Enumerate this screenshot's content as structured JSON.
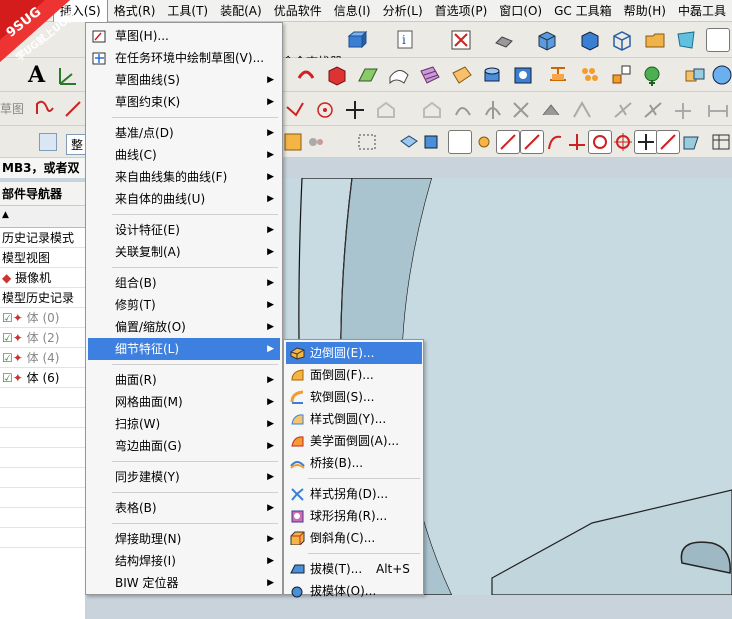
{
  "menubar": {
    "items": [
      "插入(S)",
      "格式(R)",
      "工具(T)",
      "装配(A)",
      "优品软件",
      "信息(I)",
      "分析(L)",
      "首选项(P)",
      "窗口(O)",
      "GC 工具箱",
      "帮助(H)",
      "中磊工具"
    ],
    "active_index": 0
  },
  "toolbar": {
    "command_finder": "命令查找器",
    "sketch_label": "草图",
    "text_icon": "A"
  },
  "selection_filter": {
    "value": "整"
  },
  "status_hint": "MB3，或者双",
  "navigator": {
    "title": "部件导航器",
    "rows": [
      {
        "label": "历史记录模式",
        "gray": false
      },
      {
        "label": "模型视图",
        "gray": false
      },
      {
        "label": "摄像机",
        "gray": false
      },
      {
        "label": "模型历史记录",
        "gray": false
      },
      {
        "label": "体 (0)",
        "gray": true
      },
      {
        "label": "体 (2)",
        "gray": true
      },
      {
        "label": "体 (4)",
        "gray": true
      },
      {
        "label": "体 (6)",
        "gray": false
      }
    ]
  },
  "watermark": {
    "line1": "9SUG",
    "line2": "学UG就上UG网"
  },
  "insert_menu": {
    "items": [
      {
        "label": "草图(H)...",
        "arrow": false,
        "icon": "sketch-icon"
      },
      {
        "label": "在任务环境中绘制草图(V)...",
        "arrow": false,
        "icon": "task-sketch-icon"
      },
      {
        "label": "草图曲线(S)",
        "arrow": true,
        "icon": ""
      },
      {
        "label": "草图约束(K)",
        "arrow": true,
        "icon": ""
      },
      {
        "label": "基准/点(D)",
        "arrow": true,
        "icon": ""
      },
      {
        "label": "曲线(C)",
        "arrow": true,
        "icon": ""
      },
      {
        "label": "来自曲线集的曲线(F)",
        "arrow": true,
        "icon": ""
      },
      {
        "label": "来自体的曲线(U)",
        "arrow": true,
        "icon": ""
      },
      {
        "label": "设计特征(E)",
        "arrow": true,
        "icon": ""
      },
      {
        "label": "关联复制(A)",
        "arrow": true,
        "icon": ""
      },
      {
        "label": "组合(B)",
        "arrow": true,
        "icon": ""
      },
      {
        "label": "修剪(T)",
        "arrow": true,
        "icon": ""
      },
      {
        "label": "偏置/缩放(O)",
        "arrow": true,
        "icon": ""
      },
      {
        "label": "细节特征(L)",
        "arrow": true,
        "icon": ""
      },
      {
        "label": "曲面(R)",
        "arrow": true,
        "icon": ""
      },
      {
        "label": "网格曲面(M)",
        "arrow": true,
        "icon": ""
      },
      {
        "label": "扫掠(W)",
        "arrow": true,
        "icon": ""
      },
      {
        "label": "弯边曲面(G)",
        "arrow": true,
        "icon": ""
      },
      {
        "label": "同步建模(Y)",
        "arrow": true,
        "icon": ""
      },
      {
        "label": "表格(B)",
        "arrow": true,
        "icon": ""
      },
      {
        "label": "焊接助理(N)",
        "arrow": true,
        "icon": ""
      },
      {
        "label": "结构焊接(I)",
        "arrow": true,
        "icon": ""
      },
      {
        "label": "BIW 定位器",
        "arrow": true,
        "icon": ""
      }
    ],
    "selected_index": 13
  },
  "detail_submenu": {
    "items": [
      {
        "label": "边倒圆(E)...",
        "shortcut": "",
        "icon": "edge-blend-icon"
      },
      {
        "label": "面倒圆(F)...",
        "shortcut": "",
        "icon": "face-blend-icon"
      },
      {
        "label": "软倒圆(S)...",
        "shortcut": "",
        "icon": "soft-blend-icon"
      },
      {
        "label": "样式倒圆(Y)...",
        "shortcut": "",
        "icon": "styled-blend-icon"
      },
      {
        "label": "美学面倒圆(A)...",
        "shortcut": "",
        "icon": "aesthetic-blend-icon"
      },
      {
        "label": "桥接(B)...",
        "shortcut": "",
        "icon": "bridge-icon"
      },
      {
        "label": "样式拐角(D)...",
        "shortcut": "",
        "icon": "styled-corner-icon"
      },
      {
        "label": "球形拐角(R)...",
        "shortcut": "",
        "icon": "spherical-corner-icon"
      },
      {
        "label": "倒斜角(C)...",
        "shortcut": "",
        "icon": "chamfer-icon"
      },
      {
        "label": "拔模(T)...",
        "shortcut": "Alt+S",
        "icon": "draft-icon"
      },
      {
        "label": "拔模体(O)...",
        "shortcut": "",
        "icon": "draft-body-icon"
      }
    ],
    "selected_index": 0
  }
}
